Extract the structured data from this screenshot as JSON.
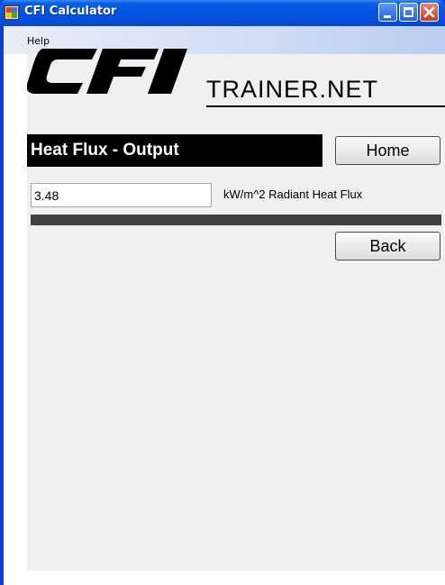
{
  "window": {
    "title": "CFI Calculator",
    "controls": [
      "minimize",
      "maximize",
      "close"
    ]
  },
  "menu": {
    "items": [
      "Help"
    ]
  },
  "logo": {
    "brand": "CFI",
    "site": "TRAINER.NET"
  },
  "form": {
    "heading": "Heat Flux - Output",
    "home_label": "Home",
    "back_label": "Back",
    "output_value": "3.48",
    "output_unit": "kW/m^2 Radiant Heat Flux"
  },
  "colors": {
    "titlebar": "#0453dd",
    "heading_bg": "#000000",
    "heading_text": "#ffffff",
    "divider": "#404040",
    "panel_bg": "#f0f0f0"
  }
}
